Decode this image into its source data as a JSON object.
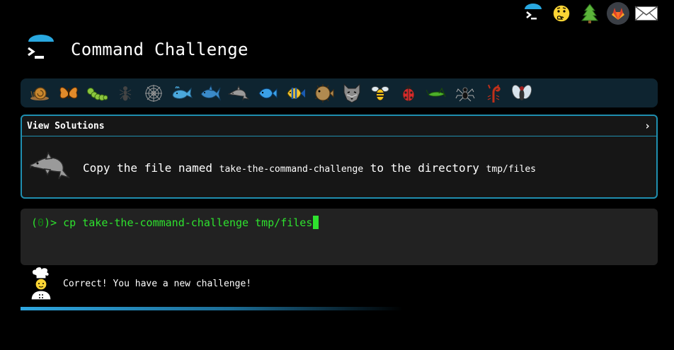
{
  "header": {
    "title": "Command Challenge",
    "accent": "#29a8e0"
  },
  "top_icons": [
    {
      "name": "terminal-logo-icon"
    },
    {
      "name": "thinking-face-icon"
    },
    {
      "name": "evergreen-tree-icon"
    },
    {
      "name": "gitlab-icon"
    },
    {
      "name": "envelope-icon"
    }
  ],
  "critters": [
    "snail",
    "butterfly",
    "caterpillar",
    "ant",
    "spider-web",
    "whale",
    "shark",
    "dolphin",
    "fish",
    "tropical-fish",
    "blowfish",
    "wolf",
    "bee",
    "ladybug",
    "cricket",
    "spider",
    "scorpion",
    "fly"
  ],
  "challenge": {
    "solutions_label": "View Solutions",
    "chevron": "›",
    "text_before": "Copy the file named ",
    "file_name": "take-the-command-challenge",
    "text_middle": " to the directory ",
    "dir_name": "tmp/files"
  },
  "terminal": {
    "prompt_open": "(",
    "prompt_zero": "0",
    "prompt_close": ")> ",
    "command": "cp take-the-command-challenge tmp/files",
    "text_color": "#2ee22e"
  },
  "feedback": {
    "message": "Correct! You have a new challenge!"
  },
  "progress": {
    "fraction": 0.6
  }
}
